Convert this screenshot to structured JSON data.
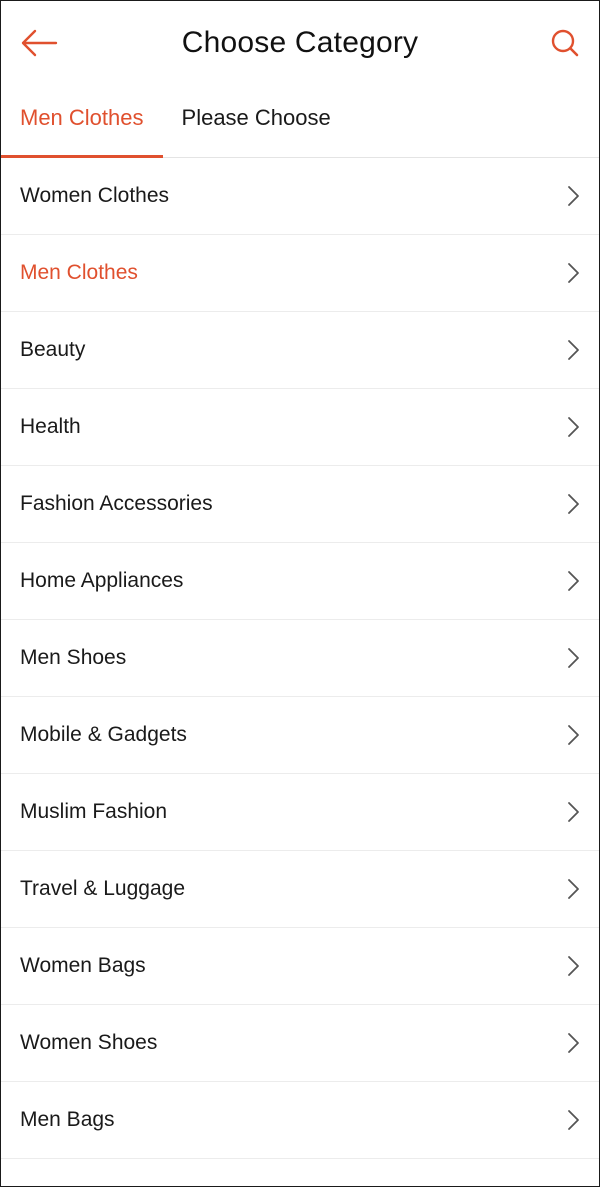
{
  "header": {
    "title": "Choose Category",
    "back_icon": "arrow-left-icon",
    "search_icon": "search-icon"
  },
  "tabs": [
    {
      "label": "Men Clothes",
      "active": true
    },
    {
      "label": "Please Choose",
      "active": false
    }
  ],
  "categories": [
    {
      "label": "Women Clothes",
      "selected": false
    },
    {
      "label": "Men Clothes",
      "selected": true
    },
    {
      "label": "Beauty",
      "selected": false
    },
    {
      "label": "Health",
      "selected": false
    },
    {
      "label": "Fashion Accessories",
      "selected": false
    },
    {
      "label": "Home Appliances",
      "selected": false
    },
    {
      "label": "Men Shoes",
      "selected": false
    },
    {
      "label": "Mobile & Gadgets",
      "selected": false
    },
    {
      "label": "Muslim Fashion",
      "selected": false
    },
    {
      "label": "Travel & Luggage",
      "selected": false
    },
    {
      "label": "Women Bags",
      "selected": false
    },
    {
      "label": "Women Shoes",
      "selected": false
    },
    {
      "label": "Men Bags",
      "selected": false
    }
  ],
  "colors": {
    "accent": "#e0502e",
    "text": "#1a1a1a",
    "divider": "#ececec",
    "chevron": "#555555"
  }
}
